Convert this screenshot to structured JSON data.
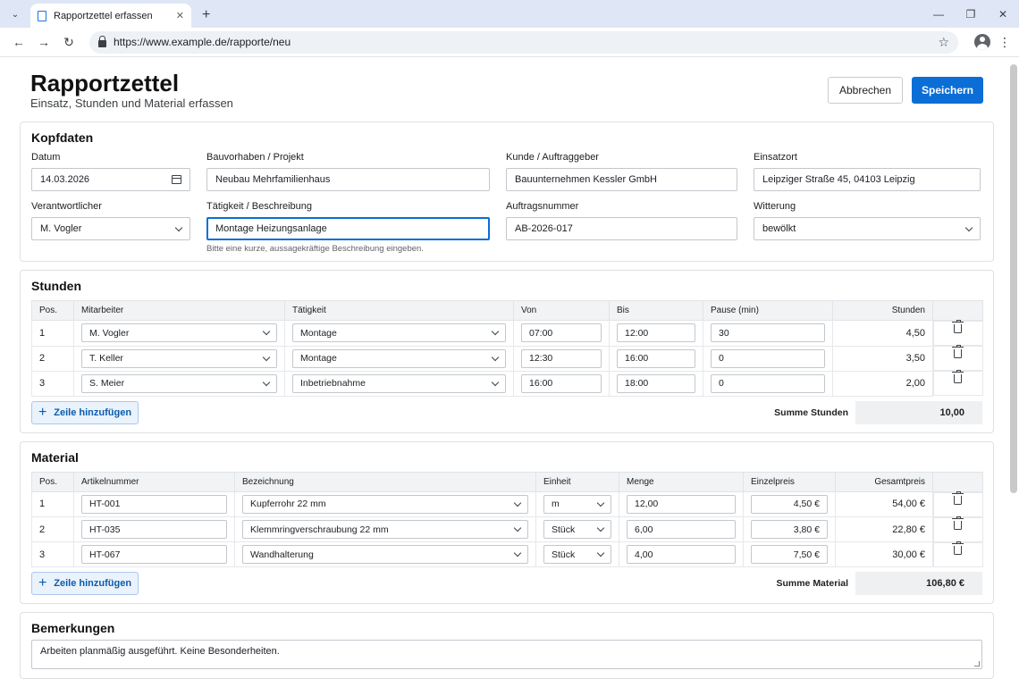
{
  "browser": {
    "tab_title": "Rapportzettel erfassen",
    "url": "https://www.example.de/rapporte/neu"
  },
  "page": {
    "title": "Rapportzettel",
    "subtitle": "Einsatz, Stunden und Material erfassen",
    "cancel_label": "Abbrechen",
    "save_label": "Speichern"
  },
  "kopf": {
    "heading": "Kopfdaten",
    "datum": {
      "label": "Datum",
      "value": "14.03.2026"
    },
    "projekt": {
      "label": "Bauvorhaben / Projekt",
      "value": "Neubau Mehrfamilienhaus"
    },
    "kunde": {
      "label": "Kunde / Auftraggeber",
      "value": "Bauunternehmen Kessler GmbH"
    },
    "einsatzort": {
      "label": "Einsatzort",
      "value": "Leipziger Straße 45, 04103 Leipzig"
    },
    "verantwortlicher": {
      "label": "Verantwortlicher",
      "value": "M. Vogler"
    },
    "taetigkeit": {
      "label": "Tätigkeit / Beschreibung",
      "value": "Montage Heizungsanlage",
      "hint": "Bitte eine kurze, aussagekräftige Beschreibung eingeben."
    },
    "auftragsnummer": {
      "label": "Auftragsnummer",
      "value": "AB-2026-017"
    },
    "witterung": {
      "label": "Witterung",
      "value": "bewölkt"
    }
  },
  "stunden": {
    "heading": "Stunden",
    "columns": [
      "Pos.",
      "Mitarbeiter",
      "Tätigkeit",
      "Von",
      "Bis",
      "Pause (min)",
      "Stunden"
    ],
    "rows": [
      {
        "pos": "1",
        "mitarbeiter": "M. Vogler",
        "taetigkeit": "Montage",
        "von": "07:00",
        "bis": "12:00",
        "pause": "30",
        "stunden": "4,50"
      },
      {
        "pos": "2",
        "mitarbeiter": "T. Keller",
        "taetigkeit": "Montage",
        "von": "12:30",
        "bis": "16:00",
        "pause": "0",
        "stunden": "3,50"
      },
      {
        "pos": "3",
        "mitarbeiter": "S. Meier",
        "taetigkeit": "Inbetriebnahme",
        "von": "16:00",
        "bis": "18:00",
        "pause": "0",
        "stunden": "2,00"
      }
    ],
    "add_label": "Zeile hinzufügen",
    "sum_label": "Summe Stunden",
    "sum_value": "10,00"
  },
  "material": {
    "heading": "Material",
    "columns": [
      "Pos.",
      "Artikelnummer",
      "Bezeichnung",
      "Einheit",
      "Menge",
      "Einzelpreis",
      "Gesamtpreis"
    ],
    "rows": [
      {
        "pos": "1",
        "artikel": "HT-001",
        "bezeichnung": "Kupferrohr 22 mm",
        "einheit": "m",
        "menge": "12,00",
        "einzelpreis": "4,50 €",
        "gesamtpreis": "54,00 €"
      },
      {
        "pos": "2",
        "artikel": "HT-035",
        "bezeichnung": "Klemmringverschraubung 22 mm",
        "einheit": "Stück",
        "menge": "6,00",
        "einzelpreis": "3,80 €",
        "gesamtpreis": "22,80 €"
      },
      {
        "pos": "3",
        "artikel": "HT-067",
        "bezeichnung": "Wandhalterung",
        "einheit": "Stück",
        "menge": "4,00",
        "einzelpreis": "7,50 €",
        "gesamtpreis": "30,00 €"
      }
    ],
    "add_label": "Zeile hinzufügen",
    "sum_label": "Summe Material",
    "sum_value": "106,80 €"
  },
  "bemerkungen": {
    "heading": "Bemerkungen",
    "value": "Arbeiten planmäßig ausgeführt. Keine Besonderheiten."
  },
  "colors": {
    "primary": "#0b6ed6",
    "tabbar": "#dfe6f5",
    "table_header": "#f1f3f5"
  }
}
